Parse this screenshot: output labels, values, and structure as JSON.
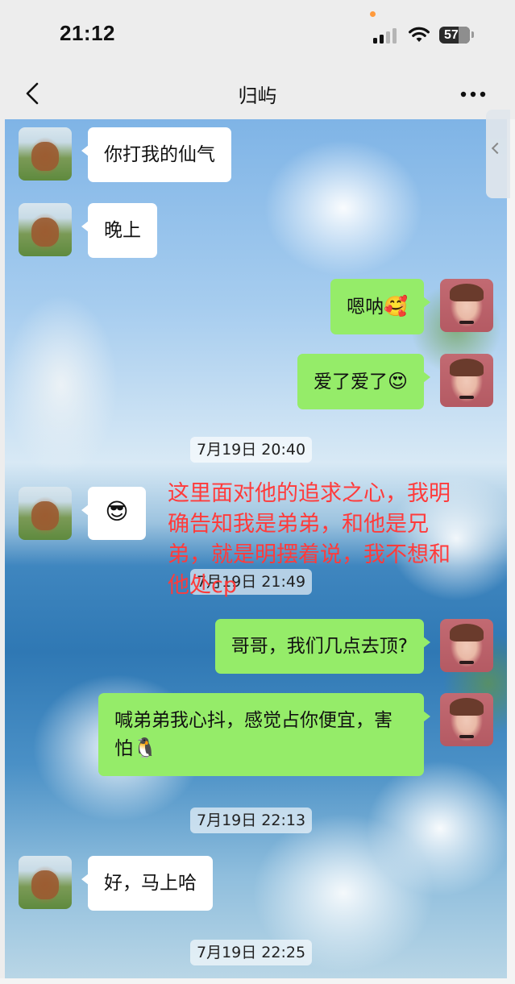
{
  "status_bar": {
    "time": "21:12",
    "battery": "57"
  },
  "nav": {
    "title": "归屿"
  },
  "messages": [
    {
      "text": "你打我的仙气"
    },
    {
      "text": "晚上"
    },
    {
      "text": "嗯呐",
      "emoji": "🥰"
    },
    {
      "text": "爱了爱了",
      "emoji": "😍"
    },
    {
      "emoji": "😎"
    },
    {
      "text": "哥哥，我们几点去顶?"
    },
    {
      "text": "喊弟弟我心抖，感觉占你便宜，害怕",
      "emoji": "🐧"
    },
    {
      "text": "好，马上哈"
    }
  ],
  "timestamps": [
    "7月19日 20:40",
    "7月19日 21:49",
    "7月19日 22:13",
    "7月19日 22:25"
  ],
  "annotation": "这里面对他的追求之心，我明确告知我是弟弟，和他是兄弟，就是明摆着说，我不想和他处cp",
  "colors": {
    "outgoing_bubble": "#95ec69",
    "incoming_bubble": "#ffffff",
    "annotation_text": "#ff3b3b",
    "nav_background": "#ededed"
  },
  "icons": {
    "back": "chevron-left-icon",
    "more": "more-dots-icon",
    "side_tab": "chevron-left-icon"
  }
}
